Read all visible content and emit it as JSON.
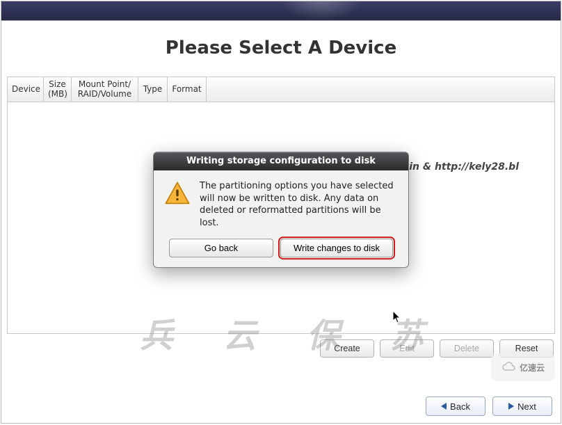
{
  "page": {
    "title": "Please Select A Device"
  },
  "table": {
    "headers": {
      "device": "Device",
      "size": "Size\n(MB)",
      "mount": "Mount Point/\nRAID/Volume",
      "type": "Type",
      "format": "Format"
    }
  },
  "actions": {
    "create": "Create",
    "edit": "Edit",
    "delete": "Delete",
    "reset": "Reset"
  },
  "nav": {
    "back": "Back",
    "next": "Next"
  },
  "dialog": {
    "title": "Writing storage configuration to disk",
    "message": "The partitioning options you have selected will now be written to disk.  Any data on deleted or reformatted partitions will be lost.",
    "go_back": "Go back",
    "write": "Write changes to disk"
  },
  "watermarks": {
    "calligraphy": "兵 云 保 苏",
    "byline": "By Kevin & http://kely28.bl",
    "brand": "亿速云"
  }
}
